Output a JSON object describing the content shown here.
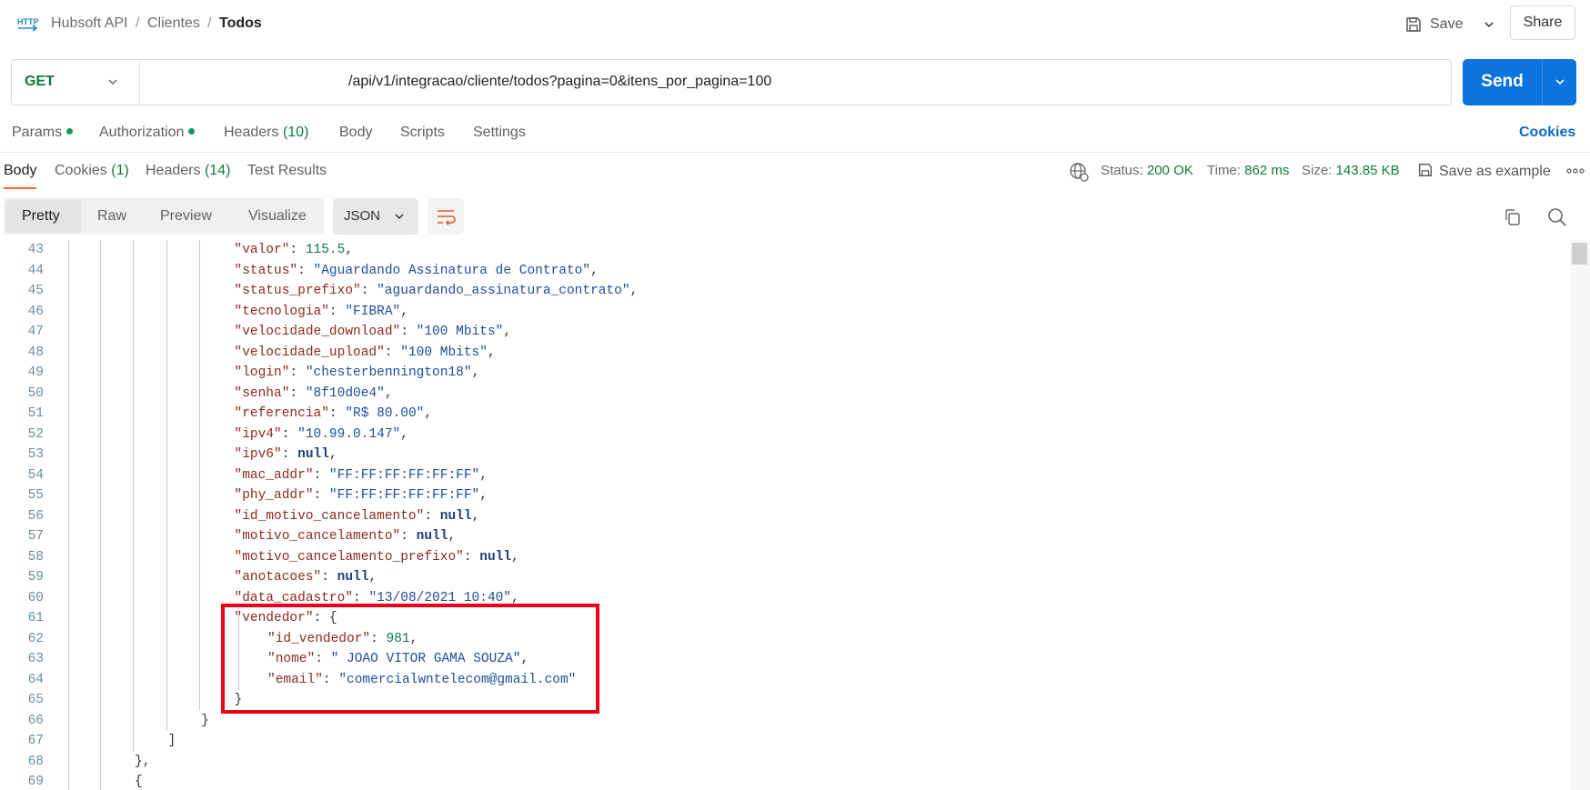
{
  "breadcrumb": {
    "collection": "Hubsoft API",
    "folder": "Clientes",
    "request": "Todos",
    "separator": "/"
  },
  "header": {
    "save_label": "Save",
    "share_label": "Share"
  },
  "request": {
    "method": "GET",
    "url": "/api/v1/integracao/cliente/todos?pagina=0&itens_por_pagina=100",
    "send_label": "Send"
  },
  "request_tabs": {
    "params": "Params",
    "authorization": "Authorization",
    "headers": "Headers",
    "headers_count": "(10)",
    "body": "Body",
    "scripts": "Scripts",
    "settings": "Settings",
    "cookies": "Cookies"
  },
  "response_tabs": {
    "body": "Body",
    "cookies": "Cookies",
    "cookies_count": "(1)",
    "headers": "Headers",
    "headers_count": "(14)",
    "test_results": "Test Results"
  },
  "status": {
    "status_label": "Status:",
    "status_value": "200 OK",
    "time_label": "Time:",
    "time_value": "862 ms",
    "size_label": "Size:",
    "size_value": "143.85 KB",
    "save_example": "Save as example"
  },
  "view_modes": {
    "pretty": "Pretty",
    "raw": "Raw",
    "preview": "Preview",
    "visualize": "Visualize",
    "format": "JSON"
  },
  "code_lines": [
    {
      "n": "43",
      "i": 5,
      "t": [
        [
          "k",
          "\"valor\""
        ],
        [
          "p",
          ": "
        ],
        [
          "n",
          "115.5"
        ],
        [
          "p",
          ","
        ]
      ]
    },
    {
      "n": "44",
      "i": 5,
      "t": [
        [
          "k",
          "\"status\""
        ],
        [
          "p",
          ": "
        ],
        [
          "s",
          "\"Aguardando Assinatura de Contrato\""
        ],
        [
          "p",
          ","
        ]
      ]
    },
    {
      "n": "45",
      "i": 5,
      "t": [
        [
          "k",
          "\"status_prefixo\""
        ],
        [
          "p",
          ": "
        ],
        [
          "s",
          "\"aguardando_assinatura_contrato\""
        ],
        [
          "p",
          ","
        ]
      ]
    },
    {
      "n": "46",
      "i": 5,
      "t": [
        [
          "k",
          "\"tecnologia\""
        ],
        [
          "p",
          ": "
        ],
        [
          "s",
          "\"FIBRA\""
        ],
        [
          "p",
          ","
        ]
      ]
    },
    {
      "n": "47",
      "i": 5,
      "t": [
        [
          "k",
          "\"velocidade_download\""
        ],
        [
          "p",
          ": "
        ],
        [
          "s",
          "\"100 Mbits\""
        ],
        [
          "p",
          ","
        ]
      ]
    },
    {
      "n": "48",
      "i": 5,
      "t": [
        [
          "k",
          "\"velocidade_upload\""
        ],
        [
          "p",
          ": "
        ],
        [
          "s",
          "\"100 Mbits\""
        ],
        [
          "p",
          ","
        ]
      ]
    },
    {
      "n": "49",
      "i": 5,
      "t": [
        [
          "k",
          "\"login\""
        ],
        [
          "p",
          ": "
        ],
        [
          "s",
          "\"chesterbennington18\""
        ],
        [
          "p",
          ","
        ]
      ]
    },
    {
      "n": "50",
      "i": 5,
      "t": [
        [
          "k",
          "\"senha\""
        ],
        [
          "p",
          ": "
        ],
        [
          "s",
          "\"8f10d0e4\""
        ],
        [
          "p",
          ","
        ]
      ]
    },
    {
      "n": "51",
      "i": 5,
      "t": [
        [
          "k",
          "\"referencia\""
        ],
        [
          "p",
          ": "
        ],
        [
          "s",
          "\"R$ 80.00\""
        ],
        [
          "p",
          ","
        ]
      ]
    },
    {
      "n": "52",
      "i": 5,
      "t": [
        [
          "k",
          "\"ipv4\""
        ],
        [
          "p",
          ": "
        ],
        [
          "s",
          "\"10.99.0.147\""
        ],
        [
          "p",
          ","
        ]
      ]
    },
    {
      "n": "53",
      "i": 5,
      "t": [
        [
          "k",
          "\"ipv6\""
        ],
        [
          "p",
          ": "
        ],
        [
          "kw",
          "null"
        ],
        [
          "p",
          ","
        ]
      ]
    },
    {
      "n": "54",
      "i": 5,
      "t": [
        [
          "k",
          "\"mac_addr\""
        ],
        [
          "p",
          ": "
        ],
        [
          "s",
          "\"FF:FF:FF:FF:FF:FF\""
        ],
        [
          "p",
          ","
        ]
      ]
    },
    {
      "n": "55",
      "i": 5,
      "t": [
        [
          "k",
          "\"phy_addr\""
        ],
        [
          "p",
          ": "
        ],
        [
          "s",
          "\"FF:FF:FF:FF:FF:FF\""
        ],
        [
          "p",
          ","
        ]
      ]
    },
    {
      "n": "56",
      "i": 5,
      "t": [
        [
          "k",
          "\"id_motivo_cancelamento\""
        ],
        [
          "p",
          ": "
        ],
        [
          "kw",
          "null"
        ],
        [
          "p",
          ","
        ]
      ]
    },
    {
      "n": "57",
      "i": 5,
      "t": [
        [
          "k",
          "\"motivo_cancelamento\""
        ],
        [
          "p",
          ": "
        ],
        [
          "kw",
          "null"
        ],
        [
          "p",
          ","
        ]
      ]
    },
    {
      "n": "58",
      "i": 5,
      "t": [
        [
          "k",
          "\"motivo_cancelamento_prefixo\""
        ],
        [
          "p",
          ": "
        ],
        [
          "kw",
          "null"
        ],
        [
          "p",
          ","
        ]
      ]
    },
    {
      "n": "59",
      "i": 5,
      "t": [
        [
          "k",
          "\"anotacoes\""
        ],
        [
          "p",
          ": "
        ],
        [
          "kw",
          "null"
        ],
        [
          "p",
          ","
        ]
      ]
    },
    {
      "n": "60",
      "i": 5,
      "t": [
        [
          "k",
          "\"data_cadastro\""
        ],
        [
          "p",
          ": "
        ],
        [
          "s",
          "\"13/08/2021 10:40\""
        ],
        [
          "p",
          ","
        ]
      ]
    },
    {
      "n": "61",
      "i": 5,
      "t": [
        [
          "k",
          "\"vendedor\""
        ],
        [
          "p",
          ": {"
        ]
      ]
    },
    {
      "n": "62",
      "i": 6,
      "t": [
        [
          "k",
          "\"id_vendedor\""
        ],
        [
          "p",
          ": "
        ],
        [
          "n",
          "981"
        ],
        [
          "p",
          ","
        ]
      ]
    },
    {
      "n": "63",
      "i": 6,
      "t": [
        [
          "k",
          "\"nome\""
        ],
        [
          "p",
          ": "
        ],
        [
          "s",
          "\" JOAO VITOR GAMA SOUZA\""
        ],
        [
          "p",
          ","
        ]
      ]
    },
    {
      "n": "64",
      "i": 6,
      "t": [
        [
          "k",
          "\"email\""
        ],
        [
          "p",
          ": "
        ],
        [
          "s",
          "\"comercialwntelecom@gmail.com\""
        ]
      ]
    },
    {
      "n": "65",
      "i": 5,
      "t": [
        [
          "p",
          "}"
        ]
      ]
    },
    {
      "n": "66",
      "i": 4,
      "t": [
        [
          "p",
          "}"
        ]
      ]
    },
    {
      "n": "67",
      "i": 3,
      "t": [
        [
          "p",
          "]"
        ]
      ]
    },
    {
      "n": "68",
      "i": 2,
      "t": [
        [
          "p",
          "},"
        ]
      ]
    },
    {
      "n": "69",
      "i": 2,
      "t": [
        [
          "p",
          "{"
        ]
      ]
    }
  ],
  "colors": {
    "accent": "#ff6c37",
    "send": "#0b74de",
    "status_ok": "#0f7b3a",
    "highlight": "#e8001c"
  }
}
